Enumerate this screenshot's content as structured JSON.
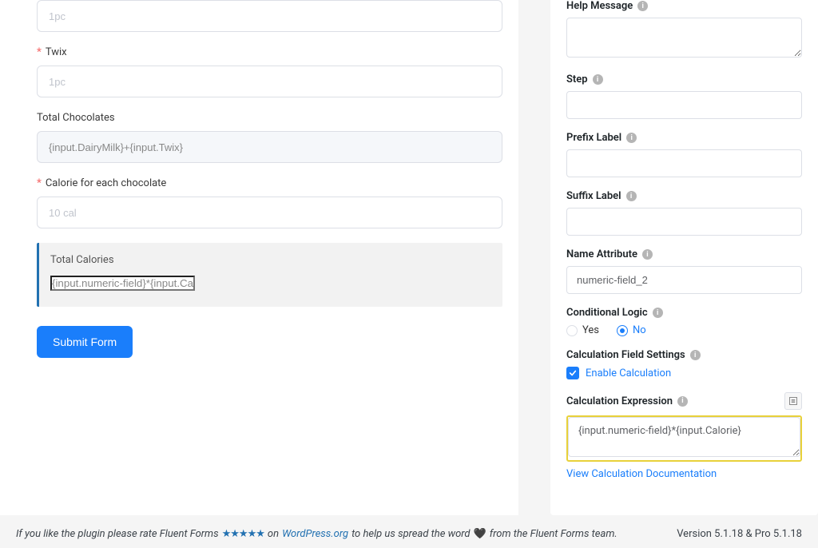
{
  "form": {
    "field1": {
      "placeholder": "1pc"
    },
    "twix": {
      "label": "Twix",
      "placeholder": "1pc"
    },
    "totalChocolates": {
      "label": "Total Chocolates",
      "value": "{input.DairyMilk}+{input.Twix}"
    },
    "calorieEach": {
      "label": "Calorie for each chocolate",
      "placeholder": "10 cal"
    },
    "totalCalories": {
      "label": "Total Calories",
      "value": "{input.numeric-field}*{input.Calorie}"
    },
    "submit": "Submit Form"
  },
  "sidebar": {
    "helpMessage": {
      "label": "Help Message"
    },
    "step": {
      "label": "Step"
    },
    "prefixLabel": {
      "label": "Prefix Label"
    },
    "suffixLabel": {
      "label": "Suffix Label"
    },
    "nameAttribute": {
      "label": "Name Attribute",
      "value": "numeric-field_2"
    },
    "conditionalLogic": {
      "label": "Conditional Logic",
      "yes": "Yes",
      "no": "No"
    },
    "calcSettings": {
      "label": "Calculation Field Settings",
      "enable": "Enable Calculation"
    },
    "calcExpression": {
      "label": "Calculation Expression",
      "value": "{input.numeric-field}*{input.Calorie}"
    },
    "docLink": "View Calculation Documentation"
  },
  "footer": {
    "prefix": "If you like the plugin please rate Fluent Forms",
    "on": "on",
    "link": "WordPress.org",
    "mid": "to help us spread the word",
    "suffix": "from the Fluent Forms team.",
    "version": "Version 5.1.18 & Pro 5.1.18"
  }
}
